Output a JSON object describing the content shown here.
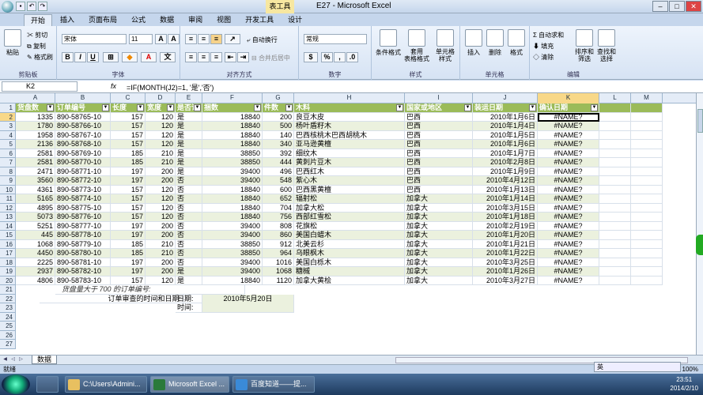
{
  "window": {
    "title": "E27 - Microsoft Excel",
    "context_tab": "表工具"
  },
  "tabs": [
    "开始",
    "插入",
    "页面布局",
    "公式",
    "数据",
    "审阅",
    "视图",
    "开发工具",
    "设计"
  ],
  "ribbon": {
    "clipboard": {
      "label": "剪贴板",
      "paste": "粘贴",
      "cut": "剪切",
      "copy": "复制",
      "format_painter": "格式刷"
    },
    "font": {
      "label": "字体",
      "name": "宋体",
      "size": "11",
      "bold": "B",
      "italic": "I",
      "underline": "U"
    },
    "alignment": {
      "label": "对齐方式",
      "wrap": "自动换行",
      "merge": "合并后居中"
    },
    "number": {
      "label": "数字",
      "format": "常规"
    },
    "styles": {
      "label": "样式",
      "conditional": "条件格式",
      "table": "套用\n表格格式",
      "cell": "单元格\n样式"
    },
    "cells": {
      "label": "单元格",
      "insert": "插入",
      "delete": "删除",
      "format": "格式"
    },
    "editing": {
      "label": "编辑",
      "autosum": "自动求和",
      "fill": "填充",
      "clear": "清除",
      "sort": "排序和\n筛选",
      "find": "查找和\n选择"
    }
  },
  "formula_bar": {
    "name_box": "K2",
    "fx": "fx",
    "formula": "=IF(MONTH(J2)=1, '是','否')"
  },
  "columns": [
    "A",
    "B",
    "C",
    "D",
    "E",
    "F",
    "G",
    "H",
    "I",
    "J",
    "K",
    "L",
    "M"
  ],
  "headers": [
    "货盘数",
    "订单编号",
    "长度",
    "宽度",
    "是否订",
    "捆数",
    "件数",
    "木料",
    "国家或地区",
    "装运日期",
    "确认日期"
  ],
  "rows": [
    [
      "1335",
      "890-58765-10",
      "157",
      "120",
      "是",
      "18840",
      "200",
      "良豆木皮",
      "巴西",
      "2010年1月6日",
      "#NAME?"
    ],
    [
      "1780",
      "890-58766-10",
      "157",
      "120",
      "是",
      "18840",
      "500",
      "杨叶盾籽木",
      "巴西",
      "2010年1月4日",
      "#NAME?"
    ],
    [
      "1958",
      "890-58767-10",
      "157",
      "120",
      "是",
      "18840",
      "140",
      "巴西核桃木巴西胡桃木",
      "巴西",
      "2010年1月5日",
      "#NAME?"
    ],
    [
      "2136",
      "890-58768-10",
      "157",
      "120",
      "是",
      "18840",
      "340",
      "亚马逊黄檀",
      "巴西",
      "2010年1月6日",
      "#NAME?"
    ],
    [
      "2581",
      "890-58769-10",
      "185",
      "210",
      "是",
      "38850",
      "392",
      "细纹木",
      "巴西",
      "2010年1月7日",
      "#NAME?"
    ],
    [
      "2581",
      "890-58770-10",
      "185",
      "210",
      "是",
      "38850",
      "444",
      "黄刺片豆木",
      "巴西",
      "2010年2月8日",
      "#NAME?"
    ],
    [
      "2471",
      "890-58771-10",
      "197",
      "200",
      "是",
      "39400",
      "496",
      "巴西红木",
      "巴西",
      "2010年1月9日",
      "#NAME?"
    ],
    [
      "3560",
      "890-58772-10",
      "197",
      "200",
      "否",
      "39400",
      "548",
      "紫心木",
      "巴西",
      "2010年4月12日",
      "#NAME?"
    ],
    [
      "4361",
      "890-58773-10",
      "157",
      "120",
      "否",
      "18840",
      "600",
      "巴西黑黄檀",
      "巴西",
      "2010年1月13日",
      "#NAME?"
    ],
    [
      "5165",
      "890-58774-10",
      "157",
      "120",
      "否",
      "18840",
      "652",
      "辐射松",
      "加拿大",
      "2010年1月14日",
      "#NAME?"
    ],
    [
      "4895",
      "890-58775-10",
      "157",
      "120",
      "否",
      "18840",
      "704",
      "加拿大松",
      "加拿大",
      "2010年3月15日",
      "#NAME?"
    ],
    [
      "5073",
      "890-58776-10",
      "157",
      "120",
      "否",
      "18840",
      "756",
      "西部红雪松",
      "加拿大",
      "2010年1月18日",
      "#NAME?"
    ],
    [
      "5251",
      "890-58777-10",
      "197",
      "200",
      "否",
      "39400",
      "808",
      "花旗松",
      "加拿大",
      "2010年2月19日",
      "#NAME?"
    ],
    [
      "445",
      "890-58778-10",
      "197",
      "200",
      "否",
      "39400",
      "860",
      "美国白蜡木",
      "加拿大",
      "2010年1月20日",
      "#NAME?"
    ],
    [
      "1068",
      "890-58779-10",
      "185",
      "210",
      "否",
      "38850",
      "912",
      "北美云杉",
      "加拿大",
      "2010年1月21日",
      "#NAME?"
    ],
    [
      "4450",
      "890-58780-10",
      "185",
      "210",
      "否",
      "38850",
      "964",
      "乌眼枫木",
      "加拿大",
      "2010年1月22日",
      "#NAME?"
    ],
    [
      "2225",
      "890-58781-10",
      "197",
      "200",
      "否",
      "39400",
      "1016",
      "美国白栎木",
      "加拿大",
      "2010年3月25日",
      "#NAME?"
    ],
    [
      "2937",
      "890-58782-10",
      "197",
      "200",
      "是",
      "39400",
      "1068",
      "糖槭",
      "加拿大",
      "2010年1月26日",
      "#NAME?"
    ],
    [
      "4806",
      "890-58783-10",
      "157",
      "120",
      "是",
      "18840",
      "1120",
      "加拿大黄桧",
      "加拿大",
      "2010年3月27日",
      "#NAME?"
    ]
  ],
  "notes": {
    "r21": "货盘量大于 700 的订单编号:",
    "r22_label": "订单审查的时间和日期:",
    "date_label": "日期:",
    "date_value": "2010年5月20日",
    "time_label": "时间:"
  },
  "row_numbers": [
    "1",
    "2",
    "3",
    "4",
    "5",
    "6",
    "7",
    "8",
    "9",
    "10",
    "11",
    "12",
    "13",
    "14",
    "15",
    "16",
    "17",
    "18",
    "19",
    "20",
    "21",
    "22",
    "23",
    "24",
    "25",
    "26",
    "27"
  ],
  "sheet": {
    "tab": "数据"
  },
  "status": {
    "mode": "就绪",
    "zoom": "100%"
  },
  "taskbar": {
    "items": [
      "C:\\Users\\Admini...",
      "Microsoft Excel ...",
      "百度知道——提..."
    ],
    "ime": "英",
    "time": "23:51",
    "date": "2014/2/10"
  }
}
